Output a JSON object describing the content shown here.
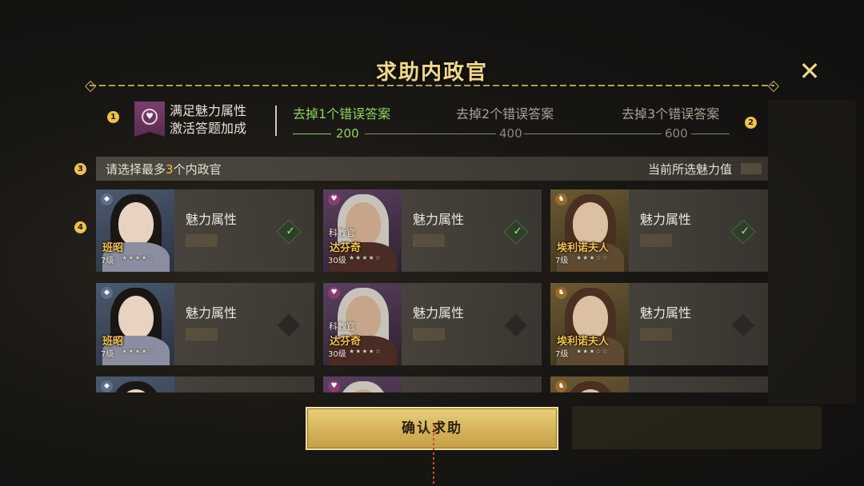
{
  "dialog": {
    "title": "求助内政官",
    "close_icon": "close-icon"
  },
  "markers": [
    "1",
    "2",
    "3",
    "4"
  ],
  "attribute": {
    "icon": "charm-heart-icon",
    "line1": "满足魅力属性",
    "line2": "激活答题加成"
  },
  "tiers": [
    {
      "label": "去掉1个错误答案",
      "value": "200",
      "active": true
    },
    {
      "label": "去掉2个错误答案",
      "value": "400",
      "active": false
    },
    {
      "label": "去掉3个错误答案",
      "value": "600",
      "active": false
    }
  ],
  "instruction": {
    "prefix": "请选择最多",
    "count": "3",
    "suffix": "个内政官",
    "current_label": "当前所选魅力值"
  },
  "cards": [
    {
      "name": "班昭",
      "subtitle": "",
      "level": "7级",
      "stars": "★★★★☆",
      "attr_label": "魅力属性",
      "checked": true,
      "badge_icon": "civil-badge-icon",
      "theme": "blue"
    },
    {
      "name": "达芬奇",
      "subtitle": "科教官",
      "level": "30级",
      "stars": "★★★★☆",
      "attr_label": "魅力属性",
      "checked": true,
      "badge_icon": "charm-heart-icon",
      "theme": "purple"
    },
    {
      "name": "埃利诺夫人",
      "subtitle": "",
      "level": "7级",
      "stars": "★★★☆☆",
      "attr_label": "魅力属性",
      "checked": true,
      "badge_icon": "lion-badge-icon",
      "theme": "gold"
    },
    {
      "name": "班昭",
      "subtitle": "",
      "level": "7级",
      "stars": "★★★★☆",
      "attr_label": "魅力属性",
      "checked": false,
      "badge_icon": "civil-badge-icon",
      "theme": "blue"
    },
    {
      "name": "达芬奇",
      "subtitle": "科教官",
      "level": "30级",
      "stars": "★★★★☆",
      "attr_label": "魅力属性",
      "checked": false,
      "badge_icon": "charm-heart-icon",
      "theme": "purple"
    },
    {
      "name": "埃利诺夫人",
      "subtitle": "",
      "level": "7级",
      "stars": "★★★☆☆",
      "attr_label": "魅力属性",
      "checked": false,
      "badge_icon": "lion-badge-icon",
      "theme": "gold"
    },
    {
      "name": "",
      "subtitle": "",
      "level": "",
      "stars": "",
      "attr_label": "",
      "checked": false,
      "badge_icon": "civil-badge-icon",
      "theme": "blue"
    },
    {
      "name": "",
      "subtitle": "",
      "level": "",
      "stars": "",
      "attr_label": "",
      "checked": false,
      "badge_icon": "charm-heart-icon",
      "theme": "purple"
    },
    {
      "name": "",
      "subtitle": "",
      "level": "",
      "stars": "",
      "attr_label": "",
      "checked": false,
      "badge_icon": "lion-badge-icon",
      "theme": "gold"
    }
  ],
  "confirm": {
    "label": "确认求助"
  },
  "colors": {
    "accent_gold": "#f3d988",
    "active_green": "#8fd35c",
    "marker_yellow": "#f1c24a"
  }
}
